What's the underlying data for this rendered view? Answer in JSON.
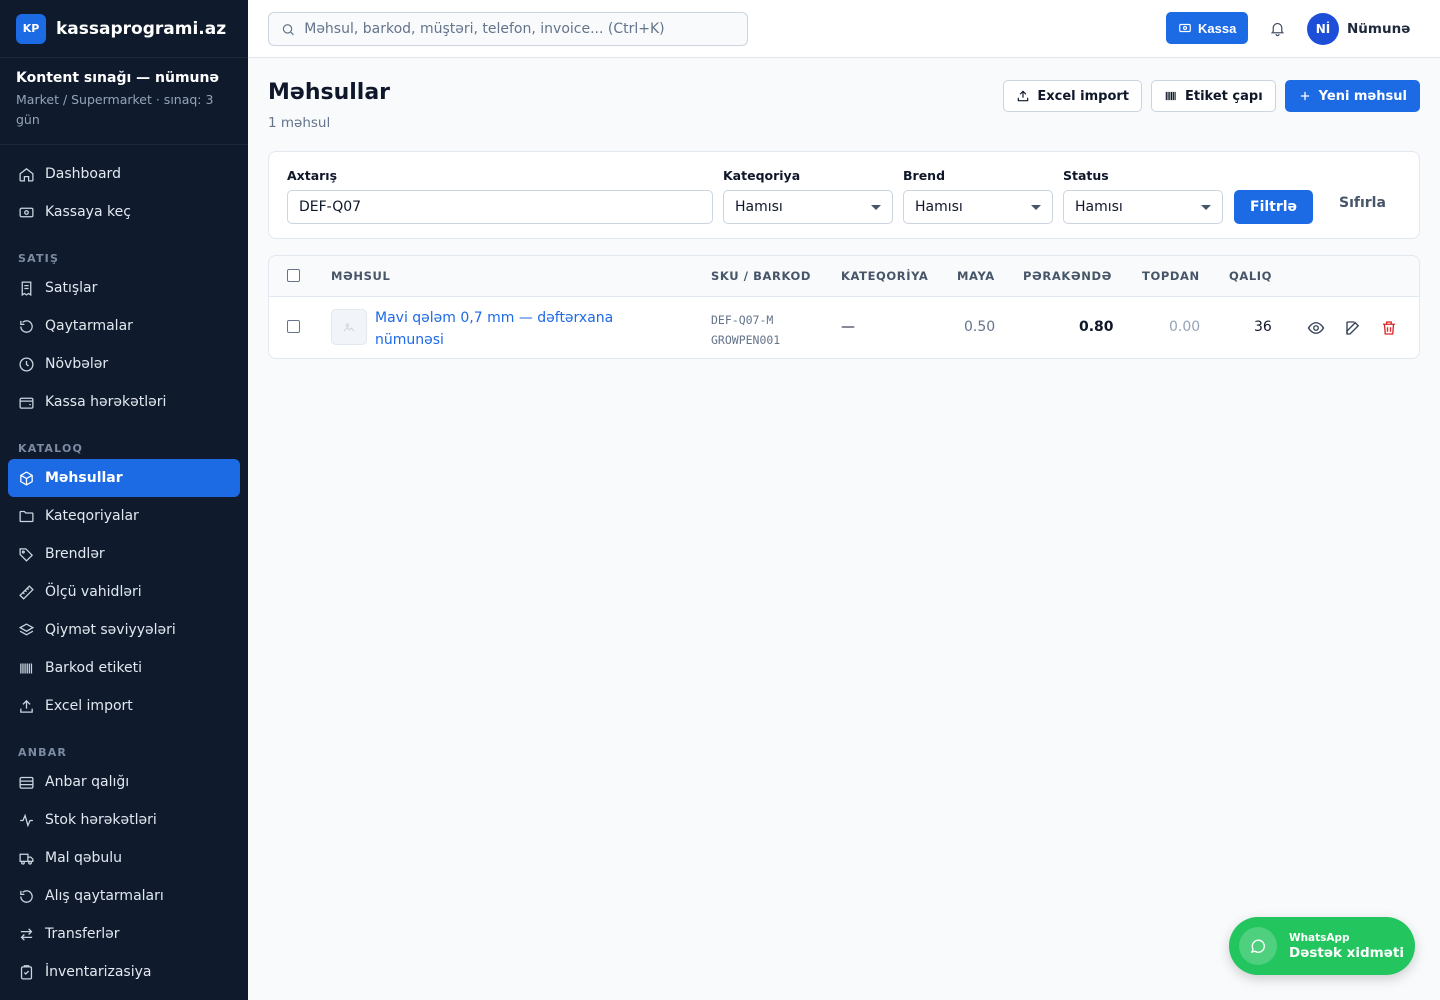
{
  "brand": {
    "logo": "KP",
    "name": "kassaprogrami.az"
  },
  "tenant": {
    "name": "Kontent sınağı — nümunə",
    "sub": "Market / Supermarket · sınaq: 3 gün"
  },
  "sidebar": {
    "top": [
      {
        "label": "Dashboard",
        "icon": "home-icon"
      },
      {
        "label": "Kassaya keç",
        "icon": "cash-icon"
      }
    ],
    "sections": [
      {
        "title": "SATIŞ",
        "items": [
          {
            "label": "Satışlar",
            "icon": "receipt-icon"
          },
          {
            "label": "Qaytarmalar",
            "icon": "undo-icon"
          },
          {
            "label": "Növbələr",
            "icon": "clock-icon"
          },
          {
            "label": "Kassa hərəkətləri",
            "icon": "wallet-icon"
          }
        ]
      },
      {
        "title": "KATALOQ",
        "items": [
          {
            "label": "Məhsullar",
            "icon": "box-icon",
            "active": true
          },
          {
            "label": "Kateqoriyalar",
            "icon": "folder-icon"
          },
          {
            "label": "Brendlər",
            "icon": "tag-icon"
          },
          {
            "label": "Ölçü vahidləri",
            "icon": "ruler-icon"
          },
          {
            "label": "Qiymət səviyyələri",
            "icon": "layers-icon"
          },
          {
            "label": "Barkod etiketi",
            "icon": "barcode-icon"
          },
          {
            "label": "Excel import",
            "icon": "upload-icon"
          }
        ]
      },
      {
        "title": "ANBAR",
        "items": [
          {
            "label": "Anbar qalığı",
            "icon": "database-icon"
          },
          {
            "label": "Stok hərəkətləri",
            "icon": "activity-icon"
          },
          {
            "label": "Mal qəbulu",
            "icon": "truck-icon"
          },
          {
            "label": "Alış qaytarmaları",
            "icon": "undo-icon"
          },
          {
            "label": "Transferlər",
            "icon": "transfer-icon"
          },
          {
            "label": "İnventarizasiya",
            "icon": "clipboard-icon"
          }
        ]
      }
    ]
  },
  "topbar": {
    "search_placeholder": "Məhsul, barkod, müştəri, telefon, invoice... (Ctrl+K)",
    "kassa_label": "Kassa",
    "avatar": "Nİ",
    "user_name": "Nümunə"
  },
  "page": {
    "title": "Məhsullar",
    "subtitle": "1 məhsul",
    "excel_import": "Excel import",
    "label_print": "Etiket çapı",
    "new_product": "Yeni məhsul"
  },
  "filters": {
    "search_label": "Axtarış",
    "search_value": "DEF-Q07",
    "category_label": "Kateqoriya",
    "category_value": "Hamısı",
    "brand_label": "Brend",
    "brand_value": "Hamısı",
    "status_label": "Status",
    "status_value": "Hamısı",
    "filter_btn": "Filtrlə",
    "reset_btn": "Sıfırla"
  },
  "table": {
    "headers": [
      "MƏHSUL",
      "SKU / BARKOD",
      "KATEQORİYA",
      "MAYA",
      "PƏRAKƏNDƏ",
      "TOPDAN",
      "QALIQ"
    ],
    "rows": [
      {
        "name": "Mavi qələm 0,7 mm — dəftərxana nümunəsi",
        "sku": "DEF-Q07-M",
        "barcode": "GROWPEN001",
        "category": "—",
        "cost": "0.50",
        "retail": "0.80",
        "wholesale": "0.00",
        "stock": "36"
      }
    ]
  },
  "whatsapp": {
    "small": "WhatsApp",
    "big": "Dəstək xidməti"
  },
  "colors": {
    "primary": "#1d6ae5",
    "sidebar": "#0f1b2d",
    "whatsapp": "#22c55e",
    "danger": "#dc2626"
  }
}
